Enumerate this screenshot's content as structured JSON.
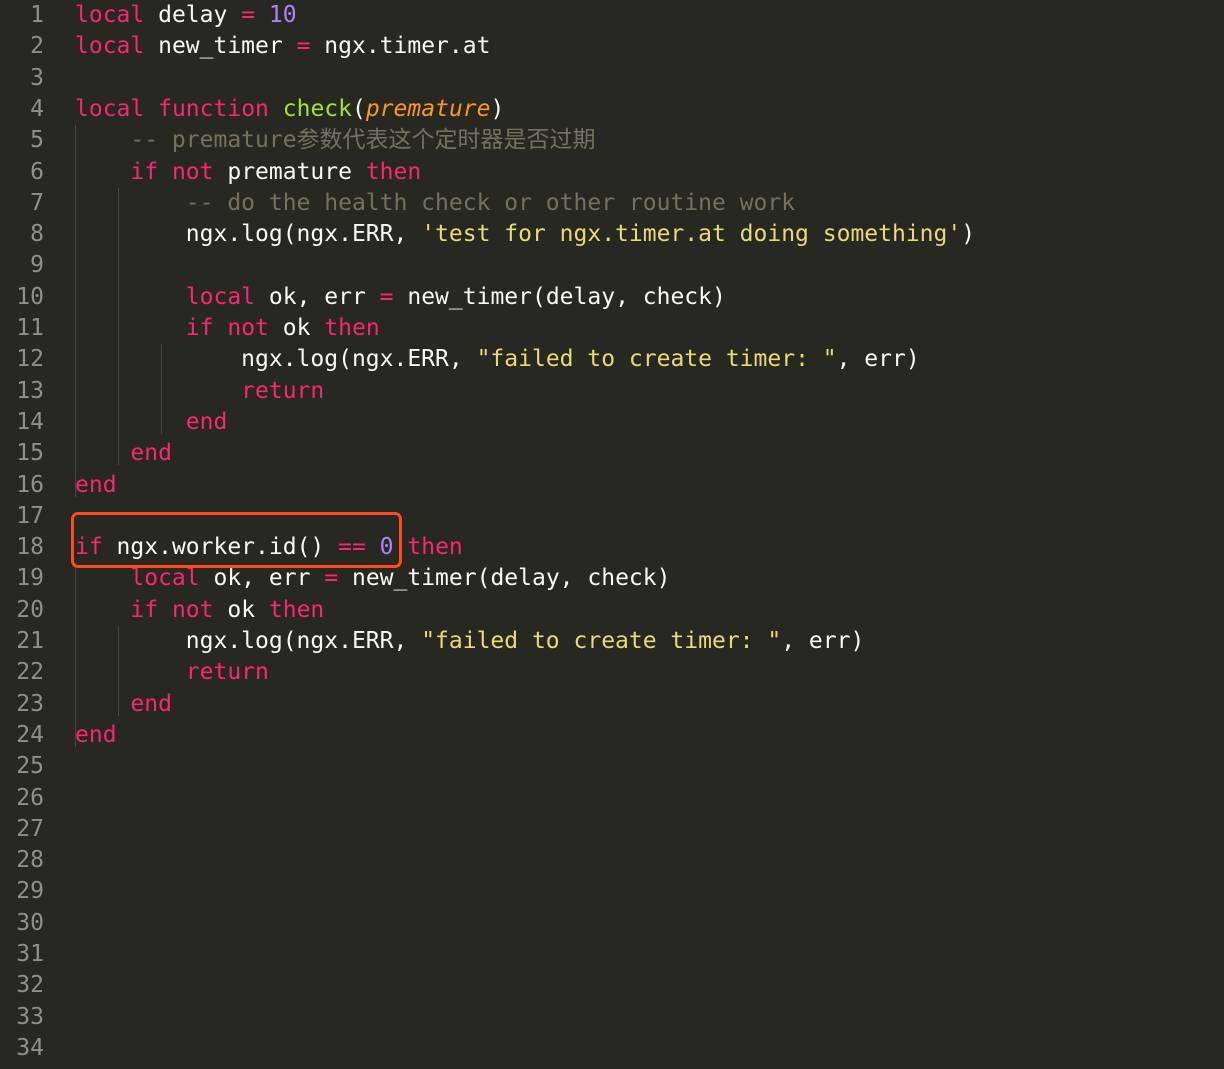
{
  "editor": {
    "theme_colors": {
      "background": "#272822",
      "keyword": "#f92672",
      "function": "#a6e22e",
      "number": "#ae81ff",
      "string": "#e6db74",
      "comment": "#75715e",
      "argument": "#fd971f",
      "line_number": "#90908a",
      "highlight_box": "#ff4a1c"
    },
    "line_numbers": [
      "1",
      "2",
      "3",
      "4",
      "5",
      "6",
      "7",
      "8",
      "9",
      "10",
      "11",
      "12",
      "13",
      "14",
      "15",
      "16",
      "17",
      "18",
      "19",
      "20",
      "21",
      "22",
      "23",
      "24",
      "25",
      "26",
      "27",
      "28",
      "29",
      "30",
      "31",
      "32",
      "33",
      "34"
    ],
    "lines": [
      [
        {
          "t": "local",
          "c": "kw"
        },
        {
          "t": " delay "
        },
        {
          "t": "=",
          "c": "op"
        },
        {
          "t": " "
        },
        {
          "t": "10",
          "c": "num"
        }
      ],
      [
        {
          "t": "local",
          "c": "kw"
        },
        {
          "t": " new_timer "
        },
        {
          "t": "=",
          "c": "op"
        },
        {
          "t": " ngx.timer.at"
        }
      ],
      [],
      [
        {
          "t": "local",
          "c": "kw"
        },
        {
          "t": " "
        },
        {
          "t": "function",
          "c": "kw"
        },
        {
          "t": " "
        },
        {
          "t": "check",
          "c": "fn"
        },
        {
          "t": "("
        },
        {
          "t": "premature",
          "c": "arg"
        },
        {
          "t": ")"
        }
      ],
      [
        {
          "t": "    "
        },
        {
          "t": "-- premature参数代表这个定时器是否过期",
          "c": "cmt"
        }
      ],
      [
        {
          "t": "    "
        },
        {
          "t": "if",
          "c": "kw"
        },
        {
          "t": " "
        },
        {
          "t": "not",
          "c": "kw"
        },
        {
          "t": " premature "
        },
        {
          "t": "then",
          "c": "kw"
        }
      ],
      [
        {
          "t": "        "
        },
        {
          "t": "-- do the health check or other routine work",
          "c": "cmt"
        }
      ],
      [
        {
          "t": "        ngx.log(ngx.ERR, "
        },
        {
          "t": "'test for ngx.timer.at doing something'",
          "c": "str"
        },
        {
          "t": ")"
        }
      ],
      [],
      [
        {
          "t": "        "
        },
        {
          "t": "local",
          "c": "kw"
        },
        {
          "t": " ok, err "
        },
        {
          "t": "=",
          "c": "op"
        },
        {
          "t": " new_timer(delay, check)"
        }
      ],
      [
        {
          "t": "        "
        },
        {
          "t": "if",
          "c": "kw"
        },
        {
          "t": " "
        },
        {
          "t": "not",
          "c": "kw"
        },
        {
          "t": " ok "
        },
        {
          "t": "then",
          "c": "kw"
        }
      ],
      [
        {
          "t": "            ngx.log(ngx.ERR, "
        },
        {
          "t": "\"failed to create timer: \"",
          "c": "str"
        },
        {
          "t": ", err)"
        }
      ],
      [
        {
          "t": "            "
        },
        {
          "t": "return",
          "c": "kw"
        }
      ],
      [
        {
          "t": "        "
        },
        {
          "t": "end",
          "c": "kw"
        }
      ],
      [
        {
          "t": "    "
        },
        {
          "t": "end",
          "c": "kw"
        }
      ],
      [
        {
          "t": "end",
          "c": "kw"
        }
      ],
      [],
      [
        {
          "t": "if",
          "c": "kw"
        },
        {
          "t": " ngx.worker.id() "
        },
        {
          "t": "==",
          "c": "op"
        },
        {
          "t": " "
        },
        {
          "t": "0",
          "c": "num"
        },
        {
          "t": " "
        },
        {
          "t": "then",
          "c": "kw"
        }
      ],
      [
        {
          "t": "    "
        },
        {
          "t": "local",
          "c": "kw"
        },
        {
          "t": " ok, err "
        },
        {
          "t": "=",
          "c": "op"
        },
        {
          "t": " new_timer(delay, check)"
        }
      ],
      [
        {
          "t": "    "
        },
        {
          "t": "if",
          "c": "kw"
        },
        {
          "t": " "
        },
        {
          "t": "not",
          "c": "kw"
        },
        {
          "t": " ok "
        },
        {
          "t": "then",
          "c": "kw"
        }
      ],
      [
        {
          "t": "        ngx.log(ngx.ERR, "
        },
        {
          "t": "\"failed to create timer: \"",
          "c": "str"
        },
        {
          "t": ", err)"
        }
      ],
      [
        {
          "t": "        "
        },
        {
          "t": "return",
          "c": "kw"
        }
      ],
      [
        {
          "t": "    "
        },
        {
          "t": "end",
          "c": "kw"
        }
      ],
      [
        {
          "t": "end",
          "c": "kw"
        }
      ],
      [],
      [],
      [],
      [],
      [],
      [],
      [],
      [],
      [],
      []
    ]
  }
}
